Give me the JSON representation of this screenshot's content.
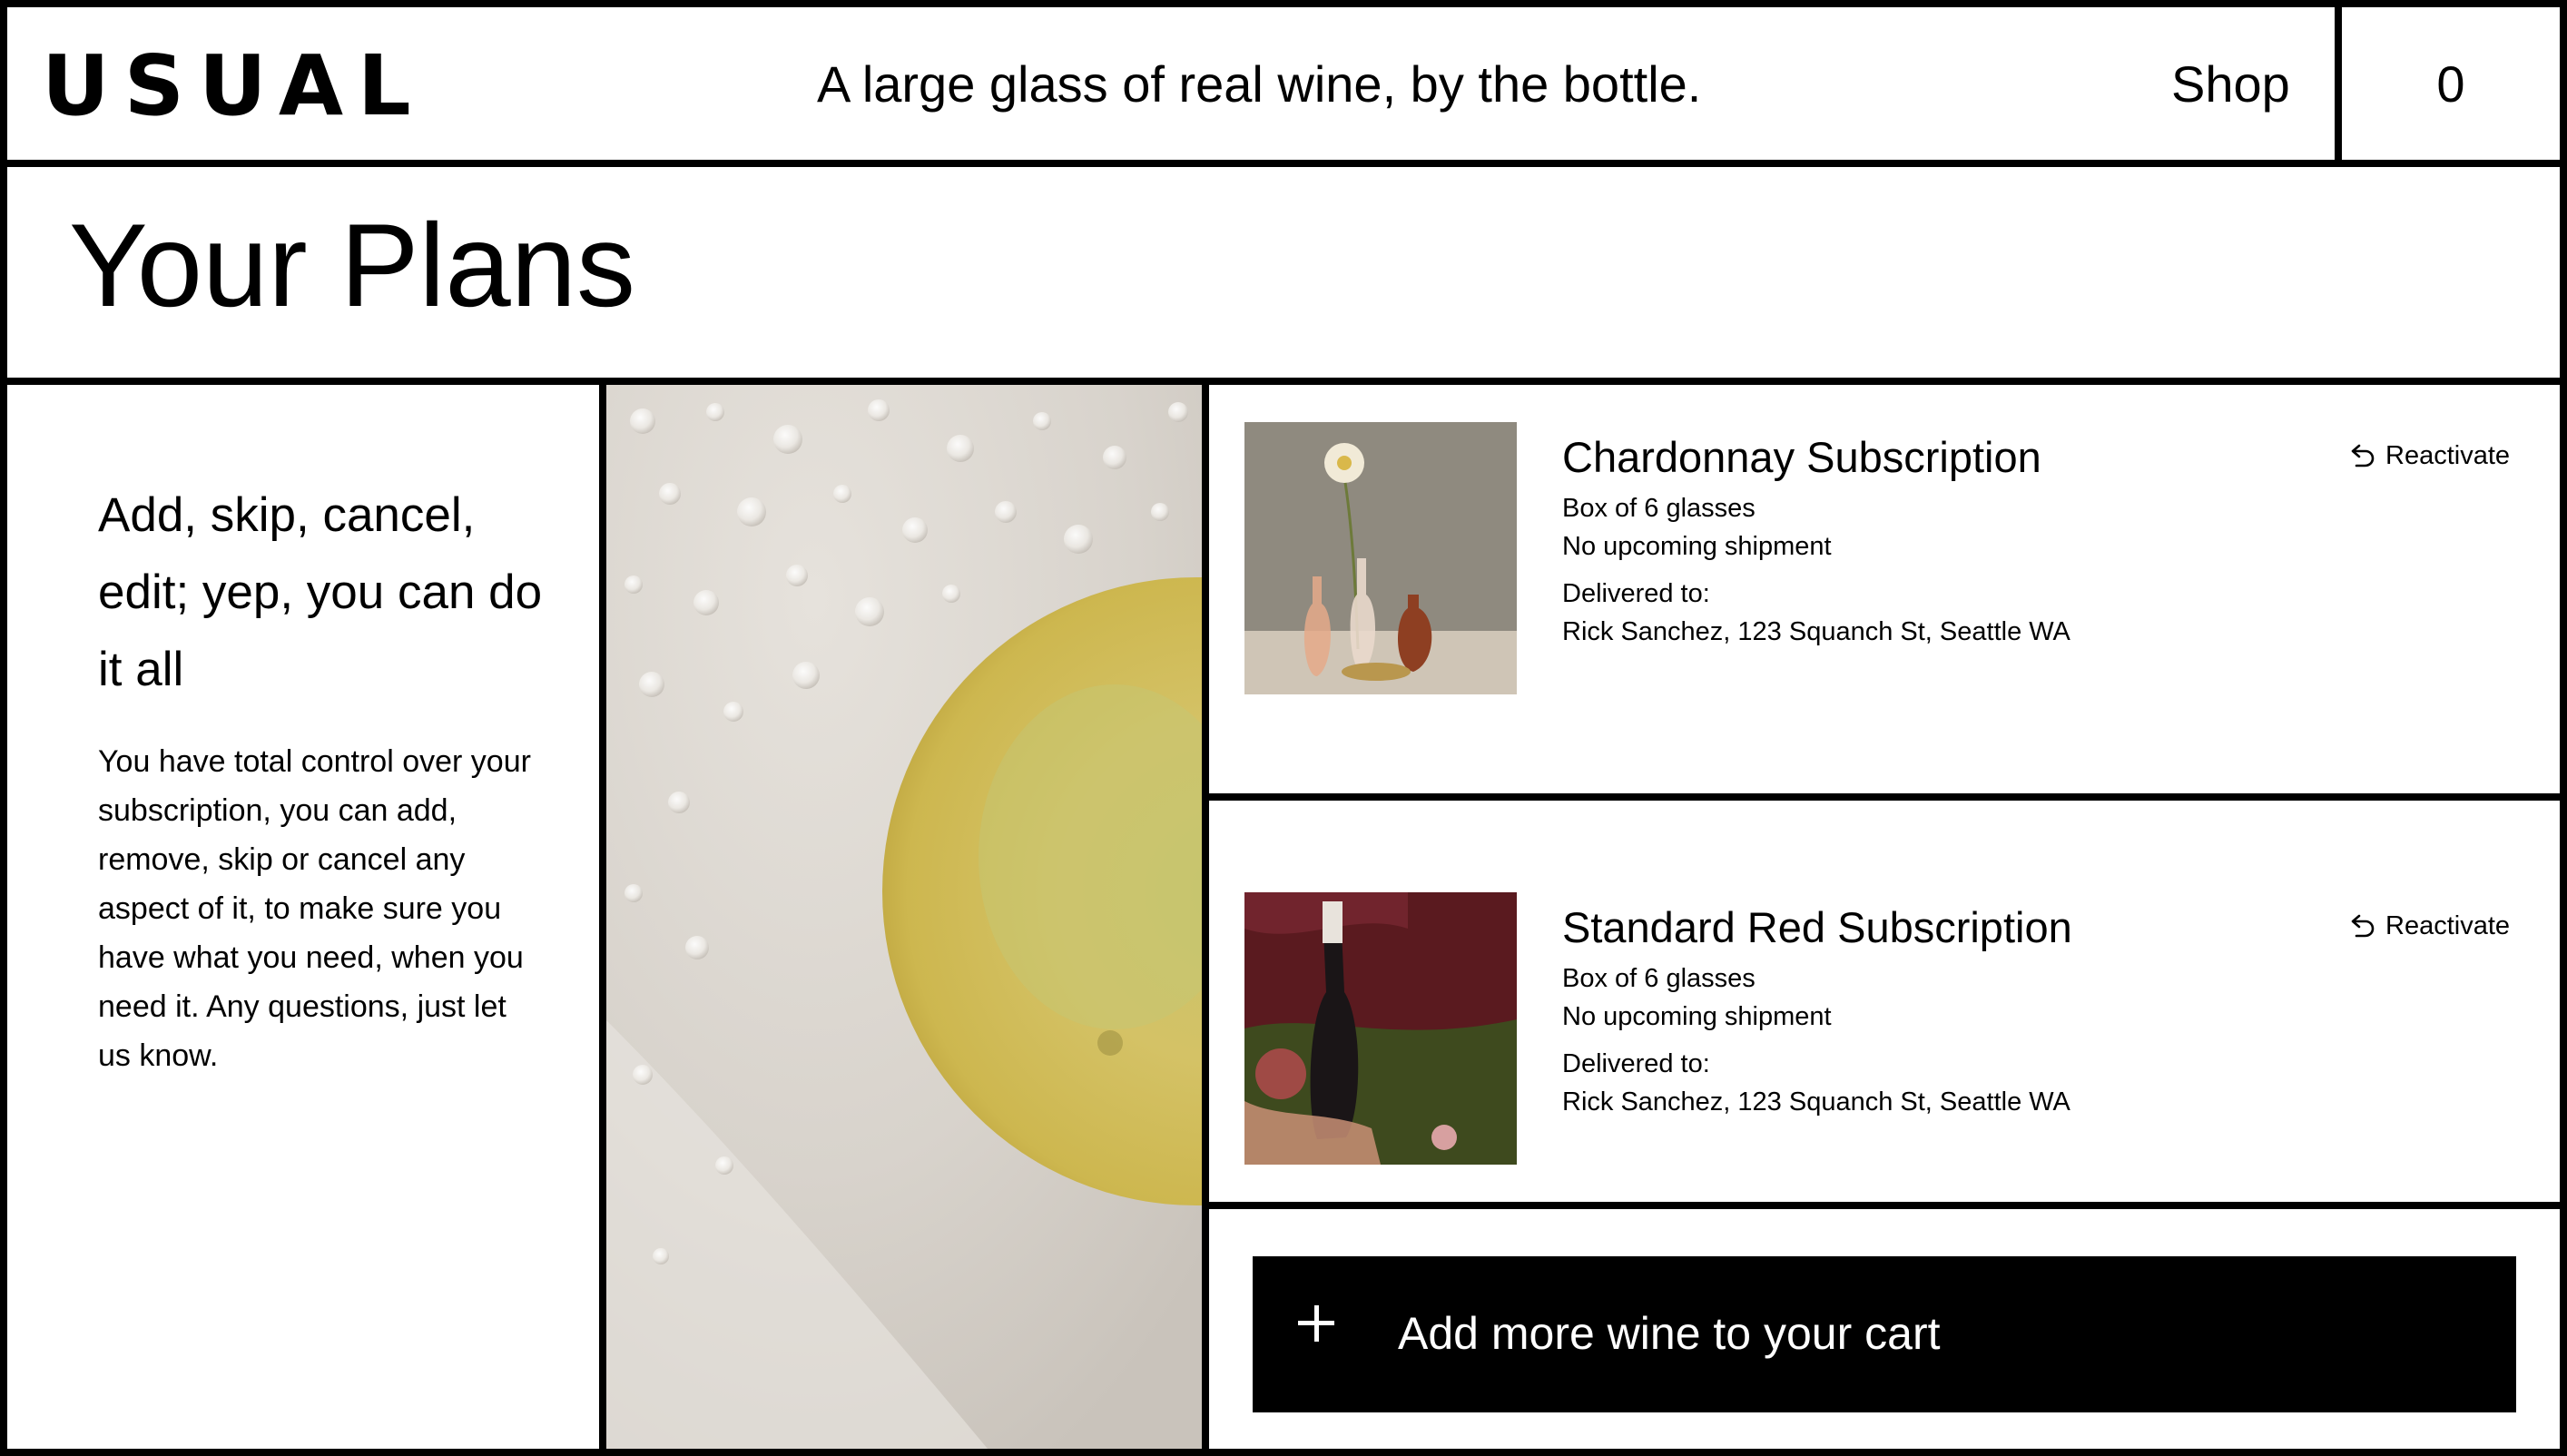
{
  "header": {
    "logo": "USUAL",
    "tagline": "A large glass of real wine, by the bottle.",
    "shop_label": "Shop",
    "cart_count": "0"
  },
  "page": {
    "title": "Your Plans"
  },
  "intro": {
    "heading": "Add, skip, cancel, edit; yep, you can do it all",
    "body": "You have total control over your subscription, you can add, remove, skip or cancel any aspect of it, to make sure you have what you need, when you need it. Any questions, just let us know."
  },
  "plans": [
    {
      "name": "Chardonnay Subscription",
      "box": "Box of 6 glasses",
      "shipment": "No upcoming shipment",
      "delivered_label": "Delivered to:",
      "address": "Rick Sanchez, 123 Squanch St, Seattle WA",
      "action_label": "Reactivate",
      "action_icon": "undo-arrow-icon"
    },
    {
      "name": "Standard Red Subscription",
      "box": "Box of 6 glasses",
      "shipment": "No upcoming shipment",
      "delivered_label": "Delivered to:",
      "address": "Rick Sanchez, 123 Squanch St, Seattle WA",
      "action_label": "Reactivate",
      "action_icon": "undo-arrow-icon"
    }
  ],
  "add_more": {
    "icon": "plus-icon",
    "label": "Add more wine to your cart"
  },
  "colors": {
    "border": "#000000",
    "background": "#ffffff",
    "button_bg": "#000000",
    "button_text": "#ffffff"
  }
}
